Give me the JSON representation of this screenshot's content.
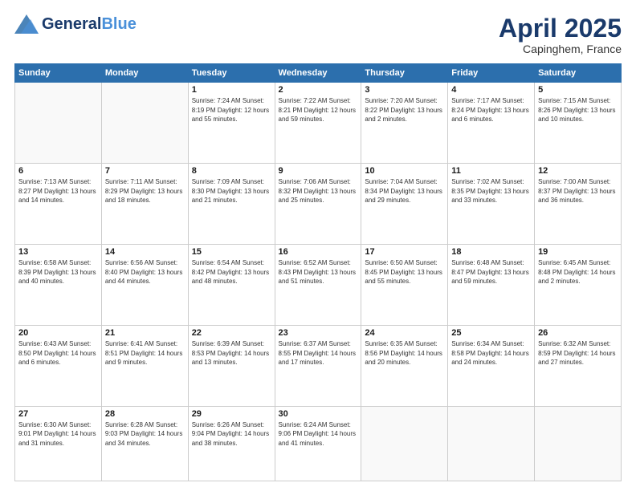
{
  "header": {
    "logo_general": "General",
    "logo_blue": "Blue",
    "month_title": "April 2025",
    "location": "Capinghem, France"
  },
  "weekdays": [
    "Sunday",
    "Monday",
    "Tuesday",
    "Wednesday",
    "Thursday",
    "Friday",
    "Saturday"
  ],
  "weeks": [
    [
      {
        "day": "",
        "info": ""
      },
      {
        "day": "",
        "info": ""
      },
      {
        "day": "1",
        "info": "Sunrise: 7:24 AM\nSunset: 8:19 PM\nDaylight: 12 hours and 55 minutes."
      },
      {
        "day": "2",
        "info": "Sunrise: 7:22 AM\nSunset: 8:21 PM\nDaylight: 12 hours and 59 minutes."
      },
      {
        "day": "3",
        "info": "Sunrise: 7:20 AM\nSunset: 8:22 PM\nDaylight: 13 hours and 2 minutes."
      },
      {
        "day": "4",
        "info": "Sunrise: 7:17 AM\nSunset: 8:24 PM\nDaylight: 13 hours and 6 minutes."
      },
      {
        "day": "5",
        "info": "Sunrise: 7:15 AM\nSunset: 8:26 PM\nDaylight: 13 hours and 10 minutes."
      }
    ],
    [
      {
        "day": "6",
        "info": "Sunrise: 7:13 AM\nSunset: 8:27 PM\nDaylight: 13 hours and 14 minutes."
      },
      {
        "day": "7",
        "info": "Sunrise: 7:11 AM\nSunset: 8:29 PM\nDaylight: 13 hours and 18 minutes."
      },
      {
        "day": "8",
        "info": "Sunrise: 7:09 AM\nSunset: 8:30 PM\nDaylight: 13 hours and 21 minutes."
      },
      {
        "day": "9",
        "info": "Sunrise: 7:06 AM\nSunset: 8:32 PM\nDaylight: 13 hours and 25 minutes."
      },
      {
        "day": "10",
        "info": "Sunrise: 7:04 AM\nSunset: 8:34 PM\nDaylight: 13 hours and 29 minutes."
      },
      {
        "day": "11",
        "info": "Sunrise: 7:02 AM\nSunset: 8:35 PM\nDaylight: 13 hours and 33 minutes."
      },
      {
        "day": "12",
        "info": "Sunrise: 7:00 AM\nSunset: 8:37 PM\nDaylight: 13 hours and 36 minutes."
      }
    ],
    [
      {
        "day": "13",
        "info": "Sunrise: 6:58 AM\nSunset: 8:39 PM\nDaylight: 13 hours and 40 minutes."
      },
      {
        "day": "14",
        "info": "Sunrise: 6:56 AM\nSunset: 8:40 PM\nDaylight: 13 hours and 44 minutes."
      },
      {
        "day": "15",
        "info": "Sunrise: 6:54 AM\nSunset: 8:42 PM\nDaylight: 13 hours and 48 minutes."
      },
      {
        "day": "16",
        "info": "Sunrise: 6:52 AM\nSunset: 8:43 PM\nDaylight: 13 hours and 51 minutes."
      },
      {
        "day": "17",
        "info": "Sunrise: 6:50 AM\nSunset: 8:45 PM\nDaylight: 13 hours and 55 minutes."
      },
      {
        "day": "18",
        "info": "Sunrise: 6:48 AM\nSunset: 8:47 PM\nDaylight: 13 hours and 59 minutes."
      },
      {
        "day": "19",
        "info": "Sunrise: 6:45 AM\nSunset: 8:48 PM\nDaylight: 14 hours and 2 minutes."
      }
    ],
    [
      {
        "day": "20",
        "info": "Sunrise: 6:43 AM\nSunset: 8:50 PM\nDaylight: 14 hours and 6 minutes."
      },
      {
        "day": "21",
        "info": "Sunrise: 6:41 AM\nSunset: 8:51 PM\nDaylight: 14 hours and 9 minutes."
      },
      {
        "day": "22",
        "info": "Sunrise: 6:39 AM\nSunset: 8:53 PM\nDaylight: 14 hours and 13 minutes."
      },
      {
        "day": "23",
        "info": "Sunrise: 6:37 AM\nSunset: 8:55 PM\nDaylight: 14 hours and 17 minutes."
      },
      {
        "day": "24",
        "info": "Sunrise: 6:35 AM\nSunset: 8:56 PM\nDaylight: 14 hours and 20 minutes."
      },
      {
        "day": "25",
        "info": "Sunrise: 6:34 AM\nSunset: 8:58 PM\nDaylight: 14 hours and 24 minutes."
      },
      {
        "day": "26",
        "info": "Sunrise: 6:32 AM\nSunset: 8:59 PM\nDaylight: 14 hours and 27 minutes."
      }
    ],
    [
      {
        "day": "27",
        "info": "Sunrise: 6:30 AM\nSunset: 9:01 PM\nDaylight: 14 hours and 31 minutes."
      },
      {
        "day": "28",
        "info": "Sunrise: 6:28 AM\nSunset: 9:03 PM\nDaylight: 14 hours and 34 minutes."
      },
      {
        "day": "29",
        "info": "Sunrise: 6:26 AM\nSunset: 9:04 PM\nDaylight: 14 hours and 38 minutes."
      },
      {
        "day": "30",
        "info": "Sunrise: 6:24 AM\nSunset: 9:06 PM\nDaylight: 14 hours and 41 minutes."
      },
      {
        "day": "",
        "info": ""
      },
      {
        "day": "",
        "info": ""
      },
      {
        "day": "",
        "info": ""
      }
    ]
  ]
}
